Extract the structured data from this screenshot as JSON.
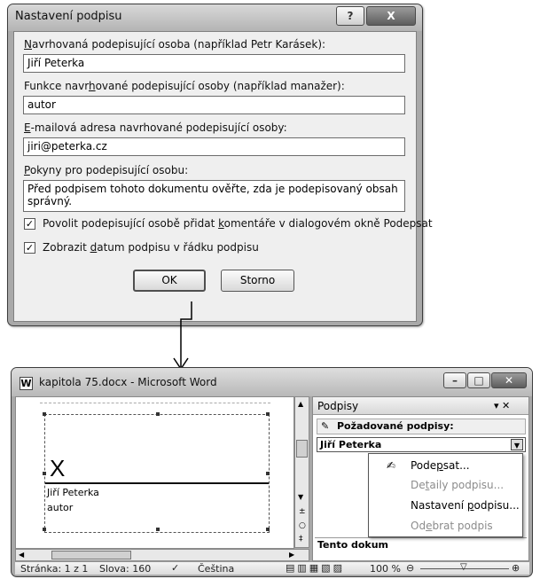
{
  "dialog": {
    "title": "Nastavení podpisu",
    "help_icon": "?",
    "close_icon": "X",
    "signer_label": {
      "pre": "",
      "ul": "N",
      "post": "avrhovaná podepisující osoba (například Petr Karásek):"
    },
    "signer_value": "Jiří Peterka",
    "function_label": {
      "pre": "Funkce navr",
      "ul": "h",
      "post": "ované podepisující osoby (například manažer):"
    },
    "function_value": "autor",
    "email_label": {
      "pre": "",
      "ul": "E",
      "post": "-mailová adresa navrhované podepisující osoby:"
    },
    "email_value": "jiri@peterka.cz",
    "instructions_label": {
      "pre": "",
      "ul": "P",
      "post": "okyny pro podepisující osobu:"
    },
    "instructions_value": "Před podpisem tohoto dokumentu ověřte, zda je podepisovaný obsah správný.",
    "allow_comments_label": {
      "pre": "Povolit podepisující osobě přidat ",
      "ul": "k",
      "post": "omentáře v dialogovém okně Podepsat"
    },
    "allow_comments_checked": true,
    "show_date_label": {
      "pre": "Zobrazit ",
      "ul": "d",
      "post": "atum podpisu v řádku podpisu"
    },
    "show_date_checked": true,
    "ok_label": "OK",
    "cancel_label": "Storno"
  },
  "word": {
    "app_icon": "W",
    "title": "kapitola 75.docx - Microsoft Word",
    "signature_line": {
      "x_mark": "X",
      "name": "Jiří Peterka",
      "role": "autor"
    },
    "pane_title": "Podpisy",
    "pane_close": "▾ ✕",
    "required_header": "Požadované podpisy:",
    "signer_row": "Jiří Peterka",
    "footer_text": "Tento dokum",
    "status": {
      "page": "Stránka: 1 z 1",
      "words": "Slova: 160",
      "language": "Čeština",
      "zoom": "100 %"
    }
  },
  "context_menu": [
    {
      "pre": "Pode",
      "ul": "p",
      "post": "sat...",
      "enabled": true,
      "icon": "signature-icon"
    },
    {
      "pre": "De",
      "ul": "t",
      "post": "aily podpisu...",
      "enabled": false
    },
    {
      "pre": "Nastavení ",
      "ul": "p",
      "post": "odpisu...",
      "enabled": true
    },
    {
      "pre": "Od",
      "ul": "e",
      "post": "brat podpis",
      "enabled": false
    }
  ]
}
